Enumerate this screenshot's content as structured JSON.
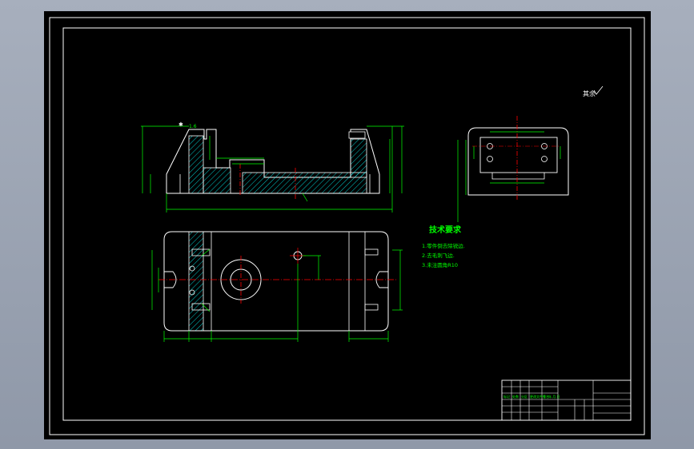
{
  "drawing": {
    "surface_mark": "其余",
    "notes_title": "技术要求",
    "notes": [
      "1.零件倒去除锐边.",
      "2.去毛刺飞边.",
      "3.未注圆角R10"
    ]
  },
  "title_block": {
    "rows": [
      "标记",
      "处数",
      "分区",
      "更改文件号",
      "签名",
      "年.月.日"
    ]
  },
  "colors": {
    "background": "#000000",
    "outline": "#ffffff",
    "dimension": "#00ff00",
    "centerline": "#ff0000",
    "hatch": "#00ffff"
  }
}
